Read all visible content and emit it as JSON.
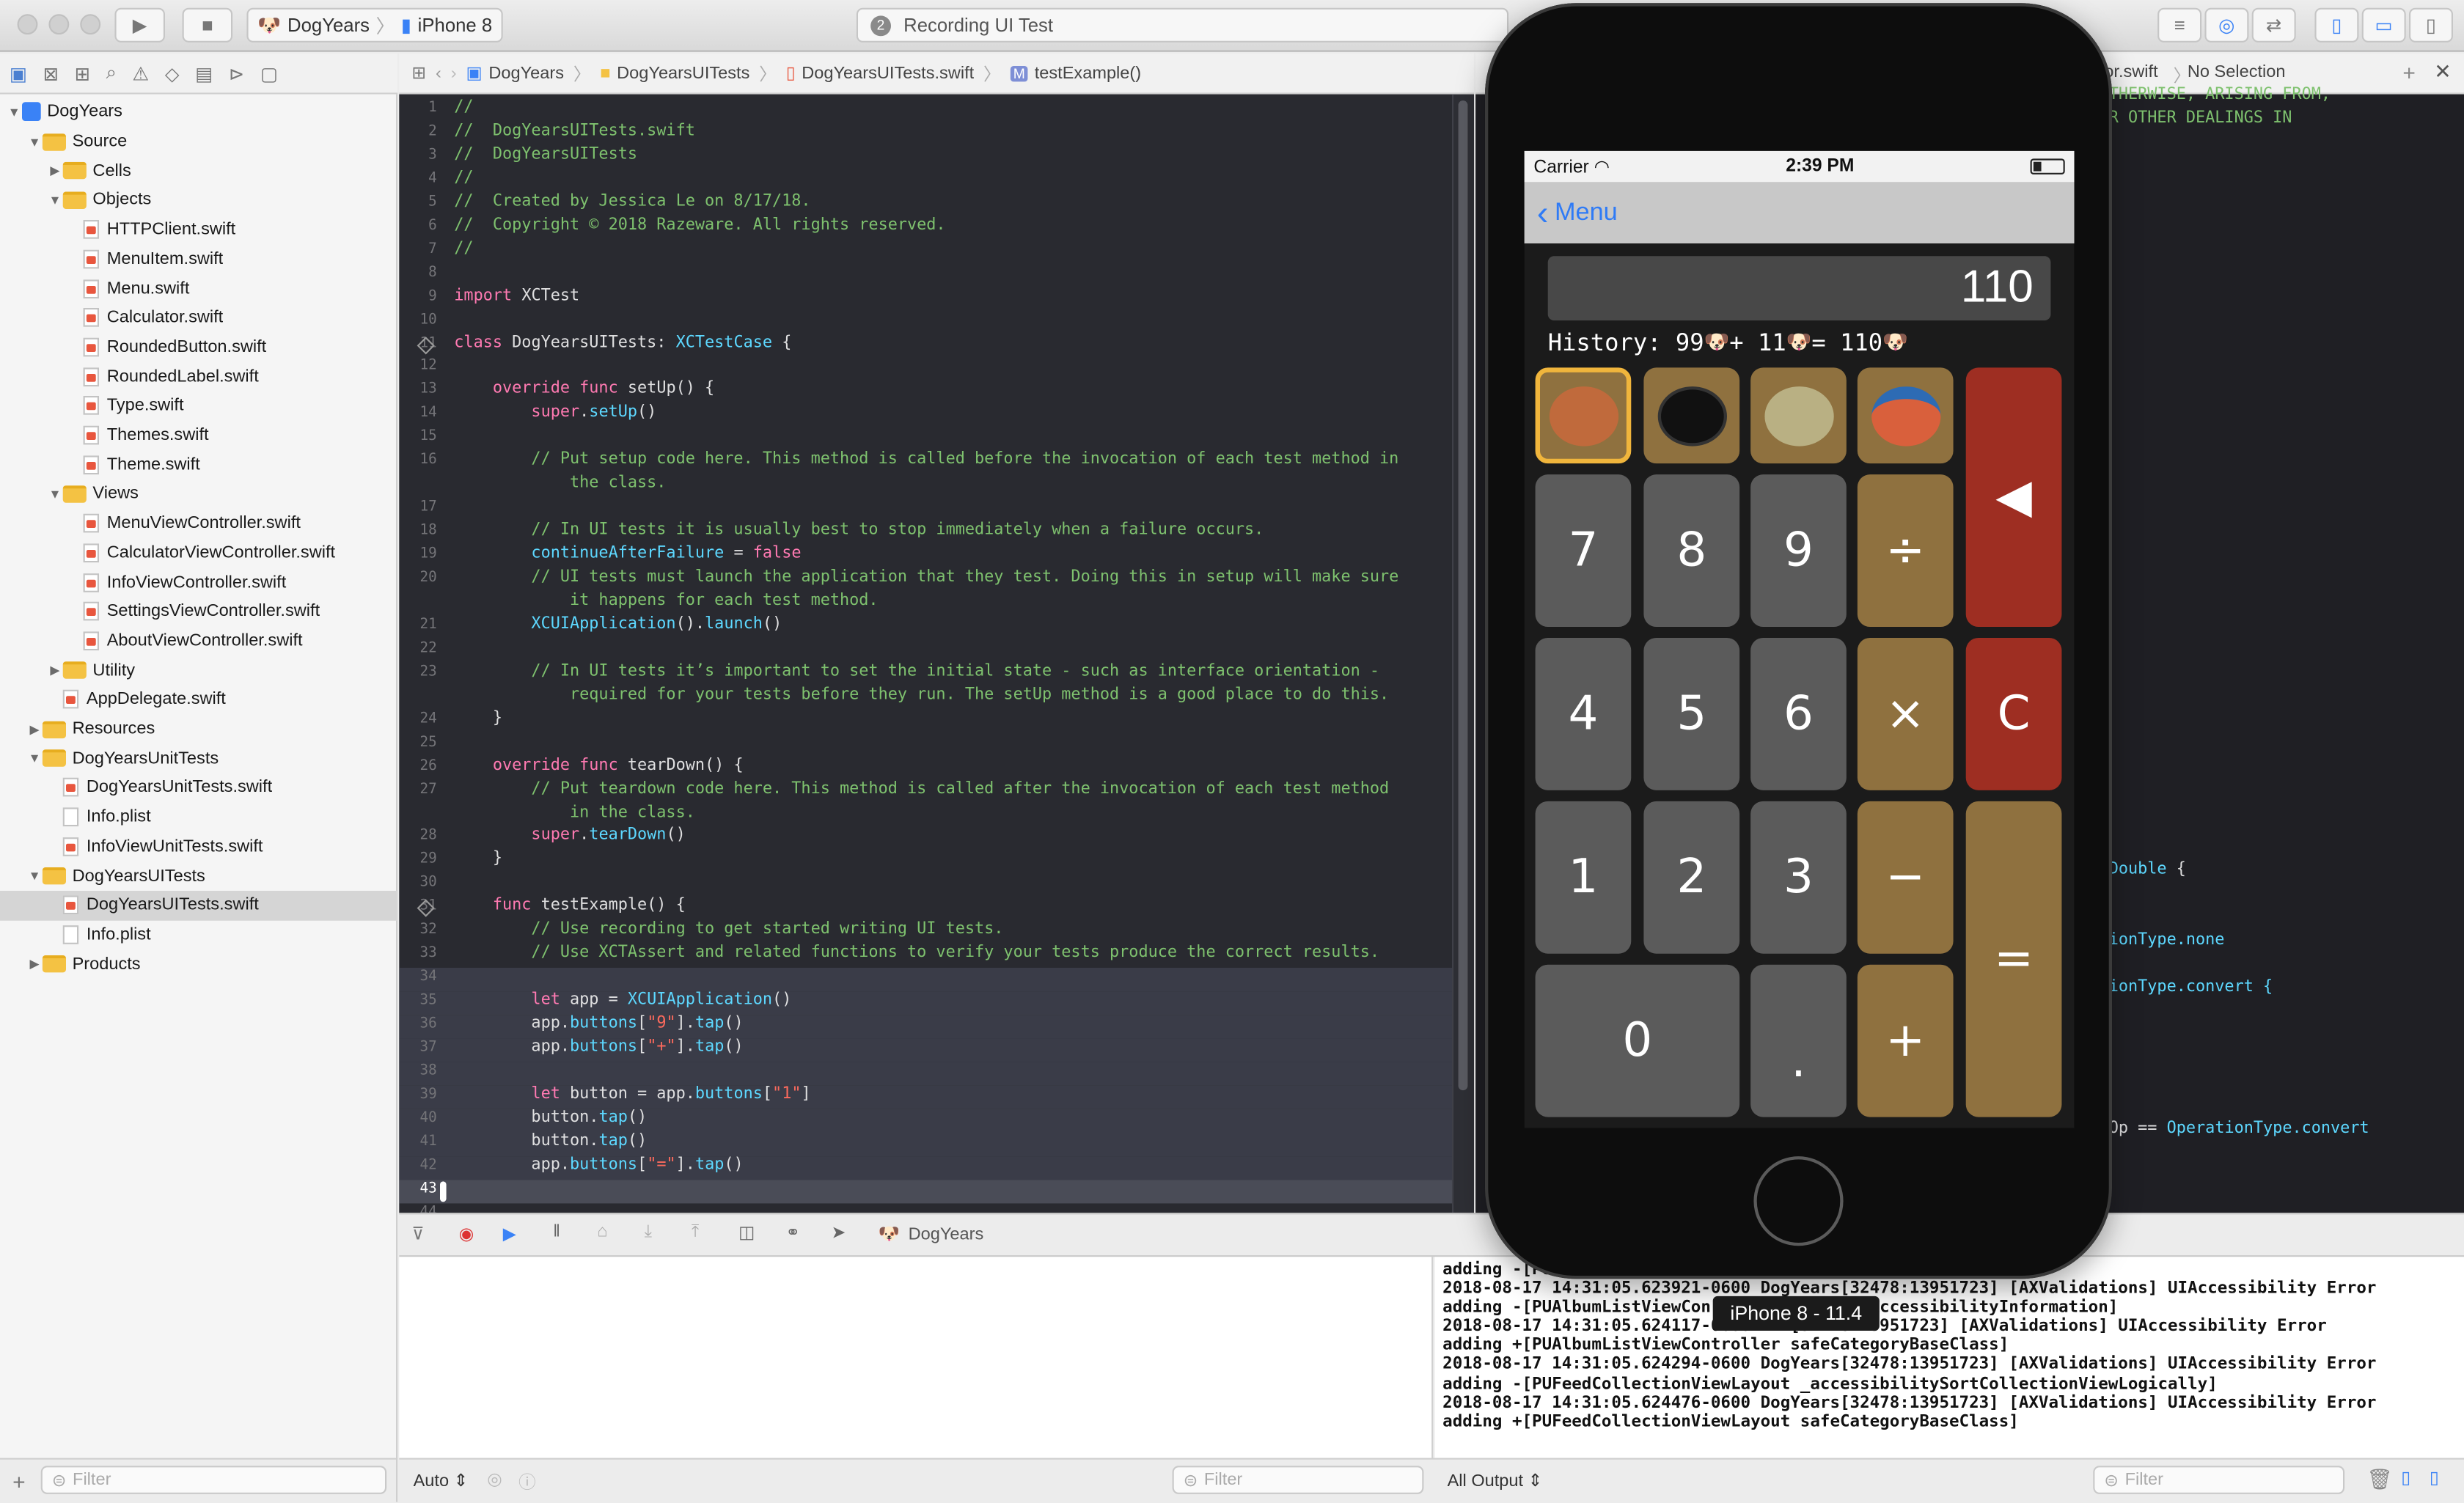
{
  "toolbar": {
    "scheme": "DogYears",
    "device": "iPhone 8",
    "activity": "Recording UI Test",
    "activity_badge": "2"
  },
  "jumpbar": {
    "crumbs": [
      "DogYears",
      "DogYearsUITests",
      "DogYearsUITests.swift",
      "testExample()"
    ],
    "method_badge": "M",
    "right_file": "or.swift",
    "right_selection": "No Selection"
  },
  "navigator": {
    "items": [
      {
        "label": "DogYears",
        "kind": "project",
        "indent": 0,
        "open": true
      },
      {
        "label": "Source",
        "kind": "folder",
        "indent": 1,
        "open": true
      },
      {
        "label": "Cells",
        "kind": "folder",
        "indent": 2,
        "open": false
      },
      {
        "label": "Objects",
        "kind": "folder",
        "indent": 2,
        "open": true
      },
      {
        "label": "HTTPClient.swift",
        "kind": "swift",
        "indent": 3
      },
      {
        "label": "MenuItem.swift",
        "kind": "swift",
        "indent": 3
      },
      {
        "label": "Menu.swift",
        "kind": "swift",
        "indent": 3
      },
      {
        "label": "Calculator.swift",
        "kind": "swift",
        "indent": 3
      },
      {
        "label": "RoundedButton.swift",
        "kind": "swift",
        "indent": 3
      },
      {
        "label": "RoundedLabel.swift",
        "kind": "swift",
        "indent": 3
      },
      {
        "label": "Type.swift",
        "kind": "swift",
        "indent": 3
      },
      {
        "label": "Themes.swift",
        "kind": "swift",
        "indent": 3
      },
      {
        "label": "Theme.swift",
        "kind": "swift",
        "indent": 3
      },
      {
        "label": "Views",
        "kind": "folder",
        "indent": 2,
        "open": true
      },
      {
        "label": "MenuViewController.swift",
        "kind": "swift",
        "indent": 3
      },
      {
        "label": "CalculatorViewController.swift",
        "kind": "swift",
        "indent": 3
      },
      {
        "label": "InfoViewController.swift",
        "kind": "swift",
        "indent": 3
      },
      {
        "label": "SettingsViewController.swift",
        "kind": "swift",
        "indent": 3
      },
      {
        "label": "AboutViewController.swift",
        "kind": "swift",
        "indent": 3
      },
      {
        "label": "Utility",
        "kind": "folder",
        "indent": 2,
        "open": false
      },
      {
        "label": "AppDelegate.swift",
        "kind": "swift",
        "indent": 2
      },
      {
        "label": "Resources",
        "kind": "folder",
        "indent": 1,
        "open": false
      },
      {
        "label": "DogYearsUnitTests",
        "kind": "folder",
        "indent": 1,
        "open": true
      },
      {
        "label": "DogYearsUnitTests.swift",
        "kind": "swift",
        "indent": 2
      },
      {
        "label": "Info.plist",
        "kind": "plist",
        "indent": 2
      },
      {
        "label": "InfoViewUnitTests.swift",
        "kind": "swift",
        "indent": 2
      },
      {
        "label": "DogYearsUITests",
        "kind": "folder",
        "indent": 1,
        "open": true
      },
      {
        "label": "DogYearsUITests.swift",
        "kind": "swift",
        "indent": 2,
        "selected": true
      },
      {
        "label": "Info.plist",
        "kind": "plist",
        "indent": 2
      },
      {
        "label": "Products",
        "kind": "folder",
        "indent": 1,
        "open": false
      }
    ],
    "filter_placeholder": "Filter"
  },
  "code": [
    {
      "n": "1",
      "t": [
        [
          "//",
          "cm"
        ]
      ]
    },
    {
      "n": "2",
      "t": [
        [
          "//  DogYearsUITests.swift",
          "cm"
        ]
      ]
    },
    {
      "n": "3",
      "t": [
        [
          "//  DogYearsUITests",
          "cm"
        ]
      ]
    },
    {
      "n": "4",
      "t": [
        [
          "//",
          "cm"
        ]
      ]
    },
    {
      "n": "5",
      "t": [
        [
          "//  Created by Jessica Le on 8/17/18.",
          "cm"
        ]
      ]
    },
    {
      "n": "6",
      "t": [
        [
          "//  Copyright © 2018 Razeware. All rights reserved.",
          "cm"
        ]
      ]
    },
    {
      "n": "7",
      "t": [
        [
          "//",
          "cm"
        ]
      ]
    },
    {
      "n": "8",
      "t": []
    },
    {
      "n": "9",
      "t": [
        [
          "import",
          "kw"
        ],
        [
          " XCTest",
          "pl"
        ]
      ]
    },
    {
      "n": "10",
      "t": []
    },
    {
      "n": "11",
      "t": [
        [
          "class",
          "kw"
        ],
        [
          " DogYearsUITests: ",
          "pl"
        ],
        [
          "XCTestCase",
          "ty"
        ],
        [
          " {",
          "pl"
        ]
      ],
      "diamond": true
    },
    {
      "n": "12",
      "t": []
    },
    {
      "n": "13",
      "t": [
        [
          "    override func",
          "kw"
        ],
        [
          " setUp() {",
          "pl"
        ]
      ]
    },
    {
      "n": "14",
      "t": [
        [
          "        super",
          "kw"
        ],
        [
          ".",
          "pl"
        ],
        [
          "setUp",
          "ty"
        ],
        [
          "()",
          "pl"
        ]
      ]
    },
    {
      "n": "15",
      "t": []
    },
    {
      "n": "16",
      "t": [
        [
          "        // Put setup code here. This method is called before the invocation of each test method in",
          "cm"
        ]
      ]
    },
    {
      "n": "",
      "t": [
        [
          "            the class.",
          "cm"
        ]
      ]
    },
    {
      "n": "17",
      "t": []
    },
    {
      "n": "18",
      "t": [
        [
          "        // In UI tests it is usually best to stop immediately when a failure occurs.",
          "cm"
        ]
      ]
    },
    {
      "n": "19",
      "t": [
        [
          "        continueAfterFailure",
          "ty"
        ],
        [
          " = ",
          "pl"
        ],
        [
          "false",
          "kw"
        ]
      ]
    },
    {
      "n": "20",
      "t": [
        [
          "        // UI tests must launch the application that they test. Doing this in setup will make sure",
          "cm"
        ]
      ]
    },
    {
      "n": "",
      "t": [
        [
          "            it happens for each test method.",
          "cm"
        ]
      ]
    },
    {
      "n": "21",
      "t": [
        [
          "        XCUIApplication",
          "ty"
        ],
        [
          "().",
          "pl"
        ],
        [
          "launch",
          "ty"
        ],
        [
          "()",
          "pl"
        ]
      ]
    },
    {
      "n": "22",
      "t": []
    },
    {
      "n": "23",
      "t": [
        [
          "        // In UI tests it’s important to set the initial state - such as interface orientation -",
          "cm"
        ]
      ]
    },
    {
      "n": "",
      "t": [
        [
          "            required for your tests before they run. The setUp method is a good place to do this.",
          "cm"
        ]
      ]
    },
    {
      "n": "24",
      "t": [
        [
          "    }",
          "pl"
        ]
      ]
    },
    {
      "n": "25",
      "t": []
    },
    {
      "n": "26",
      "t": [
        [
          "    override func",
          "kw"
        ],
        [
          " tearDown() {",
          "pl"
        ]
      ]
    },
    {
      "n": "27",
      "t": [
        [
          "        // Put teardown code here. This method is called after the invocation of each test method",
          "cm"
        ]
      ]
    },
    {
      "n": "",
      "t": [
        [
          "            in the class.",
          "cm"
        ]
      ]
    },
    {
      "n": "28",
      "t": [
        [
          "        super",
          "kw"
        ],
        [
          ".",
          "pl"
        ],
        [
          "tearDown",
          "ty"
        ],
        [
          "()",
          "pl"
        ]
      ]
    },
    {
      "n": "29",
      "t": [
        [
          "    }",
          "pl"
        ]
      ]
    },
    {
      "n": "30",
      "t": []
    },
    {
      "n": "31",
      "t": [
        [
          "    func",
          "kw"
        ],
        [
          " testExample() {",
          "pl"
        ]
      ],
      "diamond": true
    },
    {
      "n": "32",
      "t": [
        [
          "        // Use recording to get started writing UI tests.",
          "cm"
        ]
      ]
    },
    {
      "n": "33",
      "t": [
        [
          "        // Use XCTAssert and related functions to verify your tests produce the correct results.",
          "cm"
        ]
      ]
    },
    {
      "n": "34",
      "t": [],
      "hl": true
    },
    {
      "n": "35",
      "t": [
        [
          "        let",
          "kw"
        ],
        [
          " app = ",
          "pl"
        ],
        [
          "XCUIApplication",
          "ty"
        ],
        [
          "()",
          "pl"
        ]
      ],
      "hl": true
    },
    {
      "n": "36",
      "t": [
        [
          "        app.",
          "pl"
        ],
        [
          "buttons",
          "ty"
        ],
        [
          "[",
          "pl"
        ],
        [
          "\"9\"",
          "st"
        ],
        [
          "].",
          "pl"
        ],
        [
          "tap",
          "ty"
        ],
        [
          "()",
          "pl"
        ]
      ],
      "hl": true
    },
    {
      "n": "37",
      "t": [
        [
          "        app.",
          "pl"
        ],
        [
          "buttons",
          "ty"
        ],
        [
          "[",
          "pl"
        ],
        [
          "\"+\"",
          "st"
        ],
        [
          "].",
          "pl"
        ],
        [
          "tap",
          "ty"
        ],
        [
          "()",
          "pl"
        ]
      ],
      "hl": true
    },
    {
      "n": "38",
      "t": [],
      "hl": true
    },
    {
      "n": "39",
      "t": [
        [
          "        let",
          "kw"
        ],
        [
          " button = app.",
          "pl"
        ],
        [
          "buttons",
          "ty"
        ],
        [
          "[",
          "pl"
        ],
        [
          "\"1\"",
          "st"
        ],
        [
          "]",
          "pl"
        ]
      ],
      "hl": true
    },
    {
      "n": "40",
      "t": [
        [
          "        button.",
          "pl"
        ],
        [
          "tap",
          "ty"
        ],
        [
          "()",
          "pl"
        ]
      ],
      "hl": true
    },
    {
      "n": "41",
      "t": [
        [
          "        button.",
          "pl"
        ],
        [
          "tap",
          "ty"
        ],
        [
          "()",
          "pl"
        ]
      ],
      "hl": true
    },
    {
      "n": "42",
      "t": [
        [
          "        app.",
          "pl"
        ],
        [
          "buttons",
          "ty"
        ],
        [
          "[",
          "pl"
        ],
        [
          "\"=\"",
          "st"
        ],
        [
          "].",
          "pl"
        ],
        [
          "tap",
          "ty"
        ],
        [
          "()",
          "pl"
        ]
      ],
      "hl": true
    },
    {
      "n": "43",
      "t": [],
      "cursor": true
    },
    {
      "n": "44",
      "t": []
    }
  ],
  "right_editor": {
    "lines": [
      {
        "y": 0,
        "t": "THERWISE, ARISING FROM,",
        "c": "cm"
      },
      {
        "y": 1,
        "t": "R OTHER DEALINGS IN",
        "c": "cm"
      },
      {
        "y": 33,
        "t": "Double {",
        "c": "mix"
      },
      {
        "y": 36,
        "t": "ionType.none",
        "c": "ty"
      },
      {
        "y": 38,
        "t": "ionType.convert {",
        "c": "ty"
      },
      {
        "y": 44,
        "t": "Op == OperationType.convert",
        "c": "mix"
      }
    ]
  },
  "debug": {
    "scheme": "DogYears",
    "console_lines": [
      "adding -[PUAlbumListViewController ...tIndexPath:]",
      "2018-08-17 14:31:05.623921-0600 DogYears[32478:13951723] [AXValidations] UIAccessibility Error",
      "adding -[PUAlbumListViewCon... ...ilityLoadAccessibilityInformation]",
      "2018-08-17 14:31:05.624117-0600 ...[32478:13951723] [AXValidations] UIAccessibility Error",
      "adding +[PUAlbumListViewController safeCategoryBaseClass]",
      "2018-08-17 14:31:05.624294-0600 DogYears[32478:13951723] [AXValidations] UIAccessibility Error",
      "adding -[PUFeedCollectionViewLayout _accessibilitySortCollectionViewLogically]",
      "2018-08-17 14:31:05.624476-0600 DogYears[32478:13951723] [AXValidations] UIAccessibility Error",
      "adding +[PUFeedCollectionViewLayout safeCategoryBaseClass]"
    ],
    "auto_label": "Auto",
    "output_label": "All Output",
    "filter_placeholder": "Filter"
  },
  "simulator": {
    "carrier": "Carrier",
    "time": "2:39 PM",
    "back_label": "Menu",
    "display_value": "110",
    "history_prefix": "History: 99",
    "history_mid1": " + 11",
    "history_mid2": " = 110",
    "keys": {
      "seven": "7",
      "eight": "8",
      "nine": "9",
      "divide": "÷",
      "four": "4",
      "five": "5",
      "six": "6",
      "multiply": "×",
      "clear": "C",
      "one": "1",
      "two": "2",
      "three": "3",
      "minus": "−",
      "zero": "0",
      "dot": ".",
      "plus": "+",
      "equals": "=",
      "back": "◀"
    },
    "tooltip": "iPhone 8 - 11.4"
  },
  "colors": {
    "editor_bg": "#292a30",
    "keyword": "#ff7ab2",
    "comment": "#7ec16e",
    "type": "#5dd8ff",
    "string": "#fc6a5d",
    "calc_op": "#8f713f",
    "calc_num": "#5b5b5b",
    "calc_red": "#9e2e22"
  }
}
